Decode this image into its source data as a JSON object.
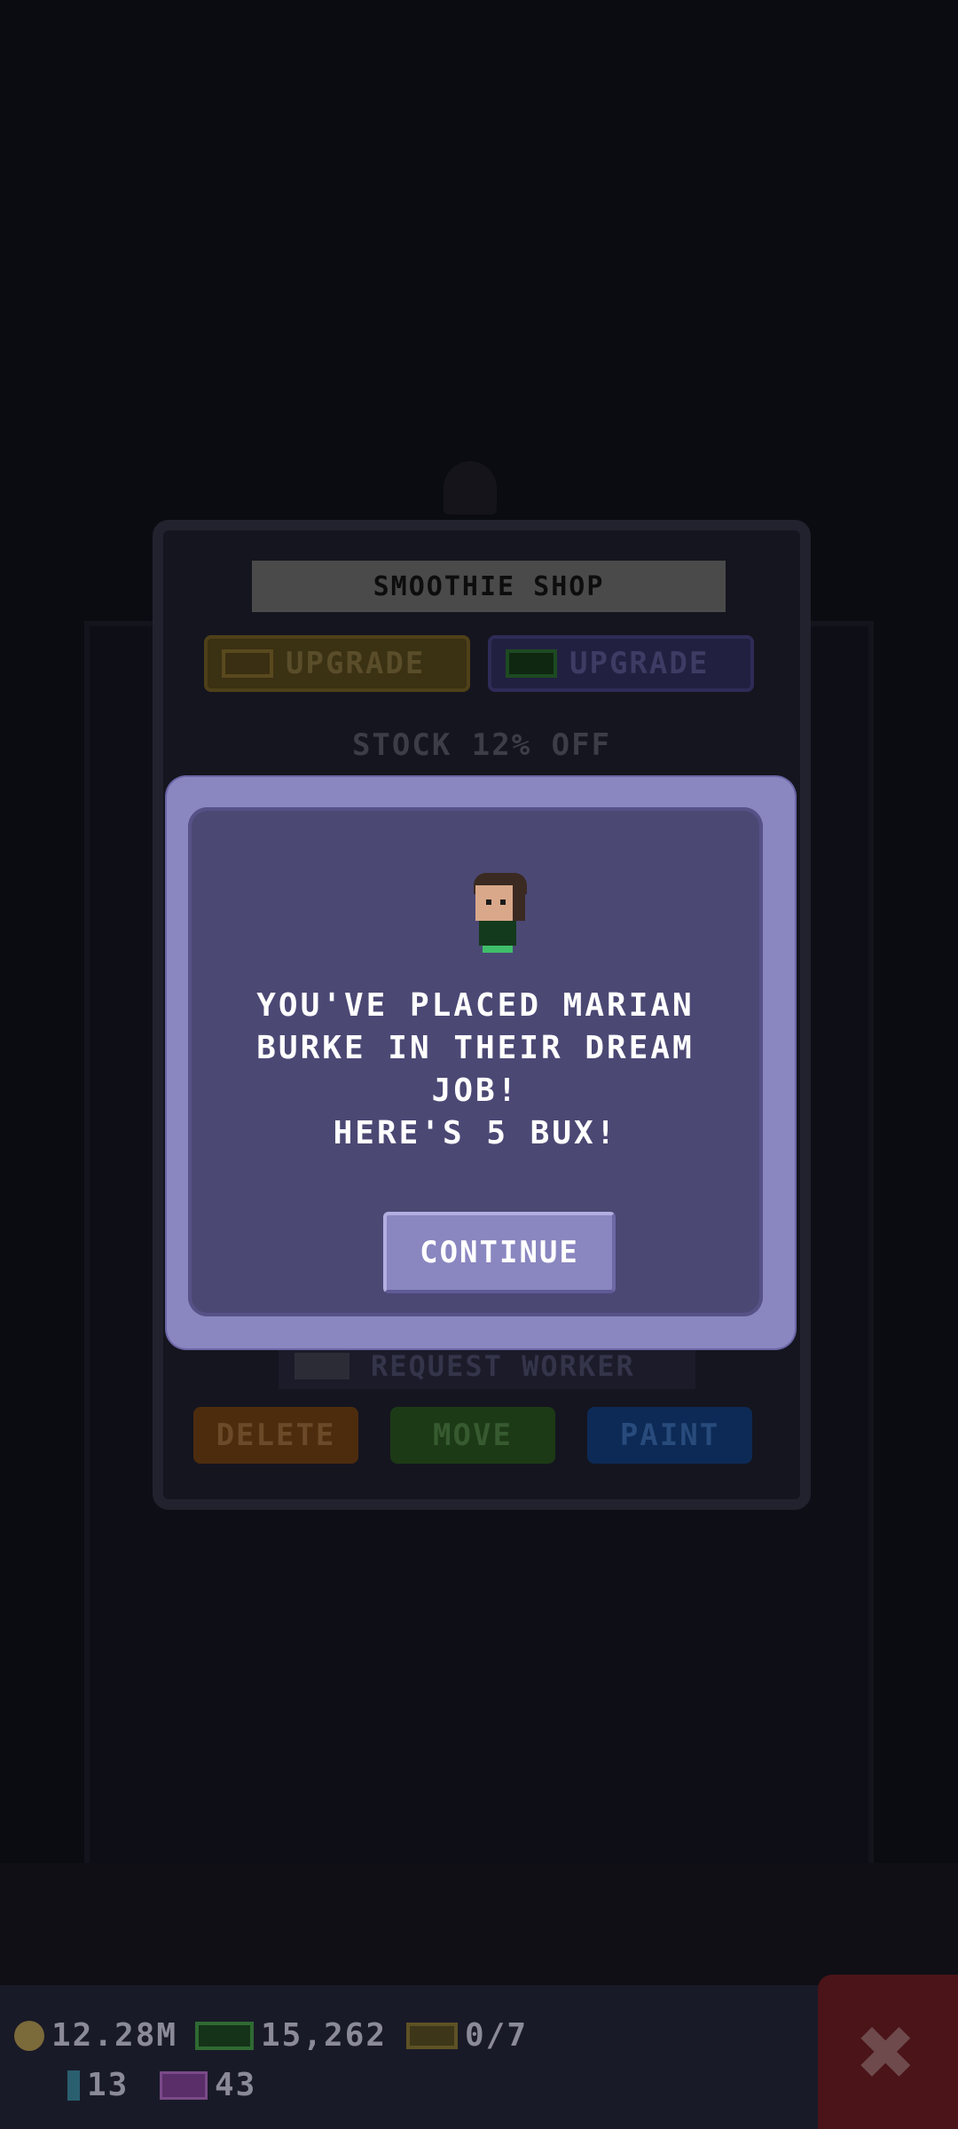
{
  "room_panel": {
    "title": "SMOOTHIE SHOP",
    "upgrade_coins_label": "UPGRADE",
    "upgrade_bux_label": "UPGRADE",
    "stock_text": "STOCK 12% OFF",
    "request_worker_label": "REQUEST WORKER",
    "delete_label": "DELETE",
    "move_label": "MOVE",
    "paint_label": "PAINT"
  },
  "dialog": {
    "message": "YOU'VE PLACED MARIAN\nBURKE IN THEIR DREAM JOB!\nHERE'S 5 BUX!",
    "continue_label": "CONTINUE"
  },
  "currency": {
    "coins": "12.28M",
    "bux": "15,262",
    "tickets": "0/7",
    "gems": "13",
    "tv": "43"
  },
  "colors": {
    "dialog_frame": "#8a86c0",
    "dialog_fill": "#4b4874",
    "close_button": "#4a1418"
  },
  "icons": {
    "close": "close-x-icon",
    "coin": "coin-icon",
    "bux": "bux-icon",
    "ticket": "ticket-icon",
    "gem": "gem-icon",
    "tv": "tv-icon"
  }
}
